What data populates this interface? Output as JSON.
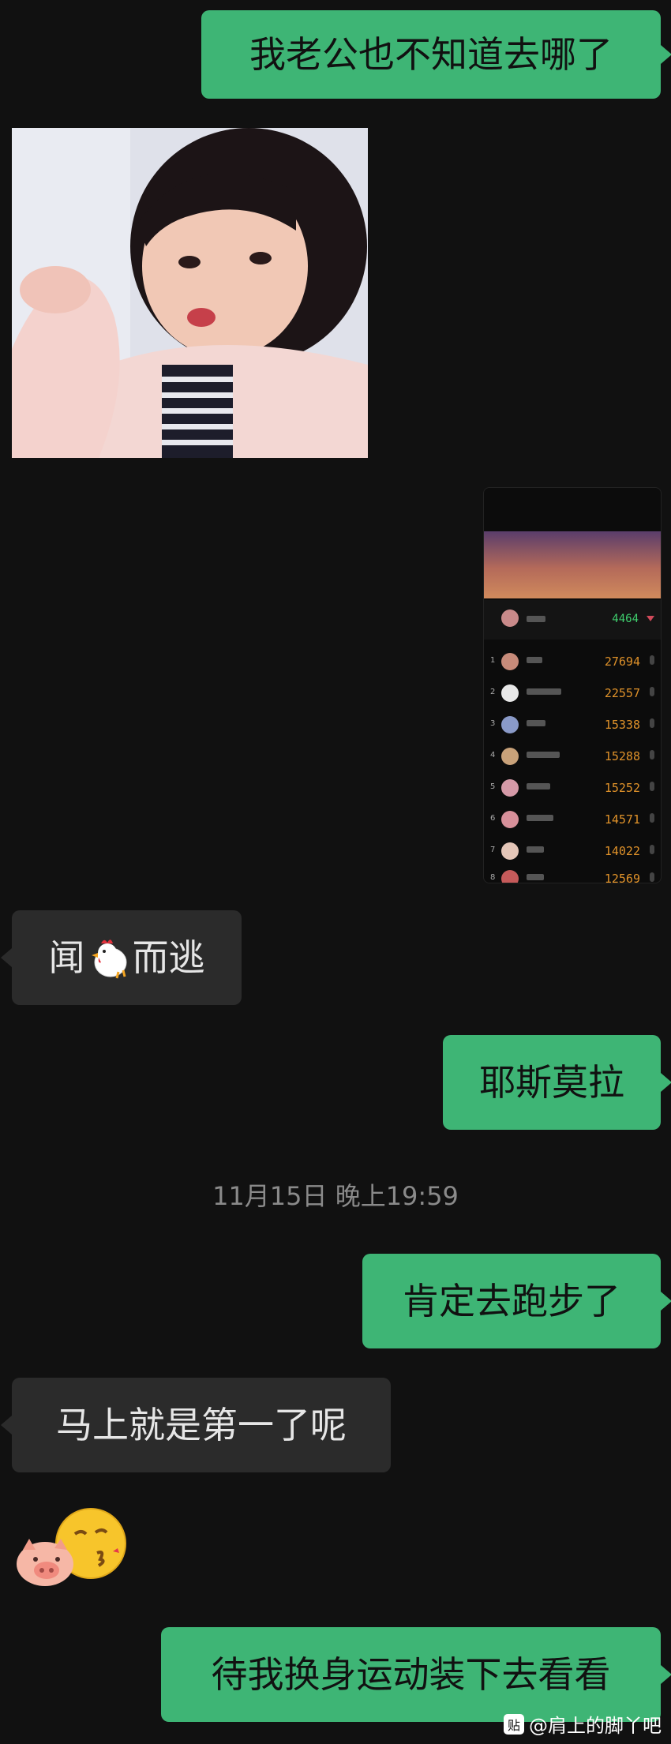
{
  "messages": {
    "m1": "我老公也不知道去哪了",
    "m3_prefix": "闻",
    "m3_suffix": "而逃",
    "m4": "耶斯莫拉",
    "timestamp": "11月15日 晚上19:59",
    "m5": "肯定去跑步了",
    "m6": "马上就是第一了呢",
    "m7": "待我换身运动装下去看看"
  },
  "leaderboard": {
    "my_value": "4464",
    "ranks": [
      "1",
      "2",
      "3",
      "4",
      "5",
      "6",
      "7",
      "8"
    ],
    "values": [
      "27694",
      "22557",
      "15338",
      "15288",
      "15252",
      "14571",
      "14022",
      "12569"
    ]
  },
  "watermark": {
    "icon": "贴",
    "text": "@肩上的脚丫吧"
  },
  "colors": {
    "outgoing_bubble": "#3eb575",
    "incoming_bubble": "#2b2b2b",
    "background": "#111111"
  }
}
